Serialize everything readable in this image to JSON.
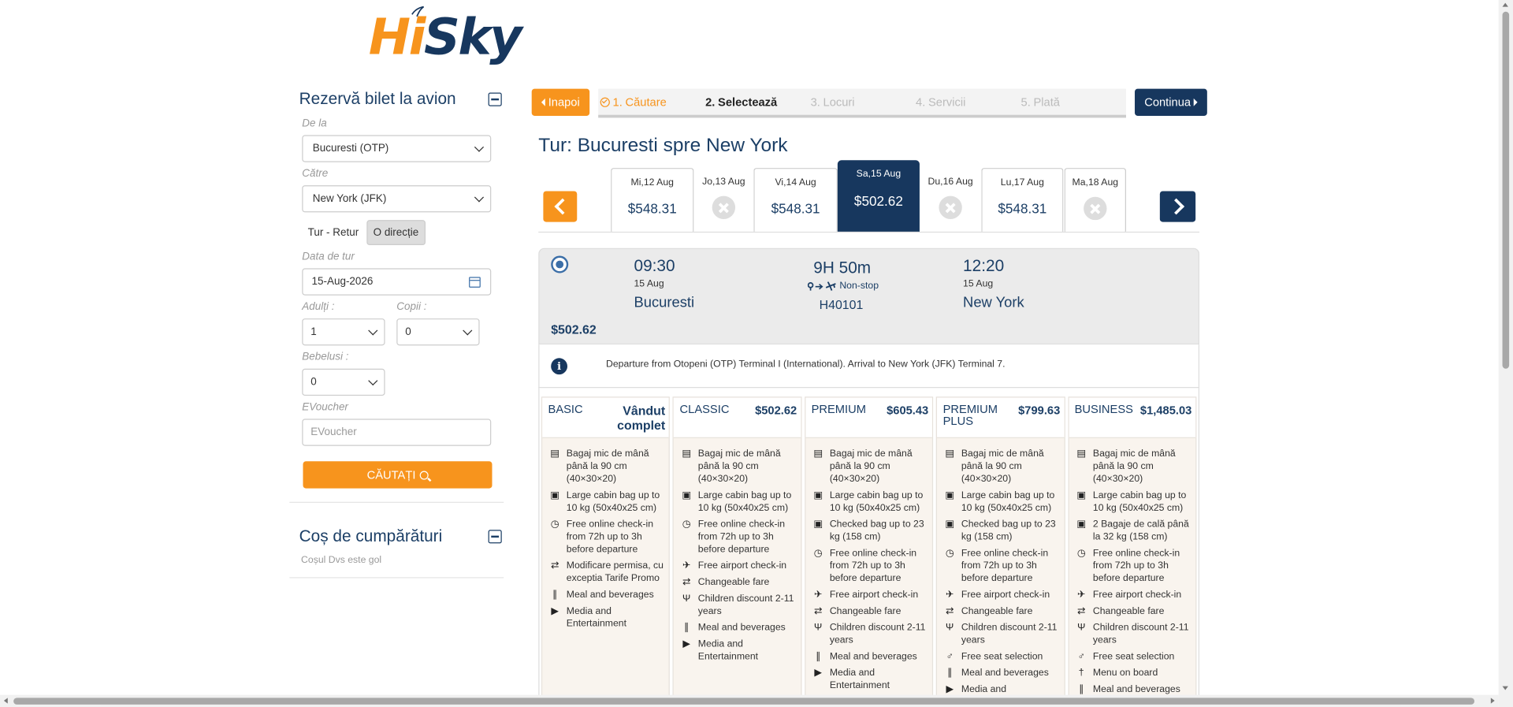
{
  "brand": {
    "hi": "Hi",
    "sky": "Sky"
  },
  "booking_panel": {
    "title": "Rezervă bilet la avion",
    "from_label": "De la",
    "from_value": "Bucuresti (OTP)",
    "to_label": "Către",
    "to_value": "New York (JFK)",
    "trip_round": "Tur - Retur",
    "trip_oneway": "O direcție",
    "date_label": "Data de tur",
    "date_value": "15-Aug-2026",
    "adults_label": "Adulți :",
    "adults_value": "1",
    "children_label": "Copii :",
    "children_value": "0",
    "infants_label": "Bebelusi :",
    "infants_value": "0",
    "voucher_label": "EVoucher",
    "voucher_placeholder": "EVoucher",
    "search_button": "CĂUTAȚI"
  },
  "cart": {
    "title": "Coș de cumpărături",
    "empty_text": "Coșul Dvs este gol"
  },
  "nav": {
    "back": "Inapoi",
    "continue": "Continua",
    "steps": [
      {
        "num": "1.",
        "label": "Căutare"
      },
      {
        "num": "2.",
        "label": "Selectează"
      },
      {
        "num": "3.",
        "label": "Locuri"
      },
      {
        "num": "4.",
        "label": "Servicii"
      },
      {
        "num": "5.",
        "label": "Plată"
      }
    ]
  },
  "route_title": "Tur: Bucuresti spre New York",
  "dates": [
    {
      "label": "Mi,12 Aug",
      "price": "$548.31",
      "available": true
    },
    {
      "label": "Jo,13 Aug",
      "price": "",
      "available": false
    },
    {
      "label": "Vi,14 Aug",
      "price": "$548.31",
      "available": true
    },
    {
      "label": "Sa,15 Aug",
      "price": "$502.62",
      "available": true,
      "selected": true
    },
    {
      "label": "Du,16 Aug",
      "price": "",
      "available": false
    },
    {
      "label": "Lu,17 Aug",
      "price": "$548.31",
      "available": true
    },
    {
      "label": "Ma,18 Aug",
      "price": "",
      "available": false
    }
  ],
  "flight": {
    "dep_time": "09:30",
    "dep_date": "15 Aug",
    "dep_city": "Bucuresti",
    "duration": "9H 50m",
    "stops": "Non-stop",
    "number": "H40101",
    "arr_time": "12:20",
    "arr_date": "15 Aug",
    "arr_city": "New York",
    "price": "$502.62",
    "info": "Departure from Otopeni (OTP) Terminal I (International). Arrival to New York (JFK) Terminal 7."
  },
  "fares": [
    {
      "name": "BASIC",
      "price": "Vândut complet",
      "sold_out": true,
      "features": [
        {
          "icon": "briefcase-icon",
          "text": "Bagaj mic de mână până la 90 cm (40×30×20)"
        },
        {
          "icon": "suitcase-icon",
          "text": "Large cabin bag up to 10 kg (50x40x25 cm)"
        },
        {
          "icon": "clock-icon",
          "text": "Free online check-in from 72h up to 3h before departure"
        },
        {
          "icon": "exchange-icon",
          "text": "Modificare permisa, cu exceptia Tarife Promo"
        },
        {
          "icon": "cutlery-icon",
          "text": "Meal and beverages"
        },
        {
          "icon": "media-icon",
          "text": "Media and Entertainment"
        }
      ]
    },
    {
      "name": "CLASSIC",
      "price": "$502.62",
      "sold_out": false,
      "features": [
        {
          "icon": "briefcase-icon",
          "text": "Bagaj mic de mână până la 90 cm (40×30×20)"
        },
        {
          "icon": "suitcase-icon",
          "text": "Large cabin bag up to 10 kg (50x40x25 cm)"
        },
        {
          "icon": "clock-icon",
          "text": "Free online check-in from 72h up to 3h before departure"
        },
        {
          "icon": "plane-icon",
          "text": "Free airport check-in"
        },
        {
          "icon": "exchange-icon",
          "text": "Changeable fare"
        },
        {
          "icon": "child-icon",
          "text": "Children discount 2-11 years"
        },
        {
          "icon": "cutlery-icon",
          "text": "Meal and beverages"
        },
        {
          "icon": "media-icon",
          "text": "Media and Entertainment"
        }
      ]
    },
    {
      "name": "PREMIUM",
      "price": "$605.43",
      "sold_out": false,
      "features": [
        {
          "icon": "briefcase-icon",
          "text": "Bagaj mic de mână până la 90 cm (40×30×20)"
        },
        {
          "icon": "suitcase-icon",
          "text": "Large cabin bag up to 10 kg (50x40x25 cm)"
        },
        {
          "icon": "suitcase-icon",
          "text": "Checked bag up to 23 kg (158 cm)"
        },
        {
          "icon": "clock-icon",
          "text": "Free online check-in from 72h up to 3h before departure"
        },
        {
          "icon": "plane-icon",
          "text": "Free airport check-in"
        },
        {
          "icon": "exchange-icon",
          "text": "Changeable fare"
        },
        {
          "icon": "child-icon",
          "text": "Children discount 2-11 years"
        },
        {
          "icon": "cutlery-icon",
          "text": "Meal and beverages"
        },
        {
          "icon": "media-icon",
          "text": "Media and Entertainment"
        }
      ]
    },
    {
      "name": "PREMIUM PLUS",
      "price": "$799.63",
      "sold_out": false,
      "features": [
        {
          "icon": "briefcase-icon",
          "text": "Bagaj mic de mână până la 90 cm (40×30×20)"
        },
        {
          "icon": "suitcase-icon",
          "text": "Large cabin bag up to 10 kg (50x40x25 cm)"
        },
        {
          "icon": "suitcase-icon",
          "text": "Checked bag up to 23 kg (158 cm)"
        },
        {
          "icon": "clock-icon",
          "text": "Free online check-in from 72h up to 3h before departure"
        },
        {
          "icon": "plane-icon",
          "text": "Free airport check-in"
        },
        {
          "icon": "exchange-icon",
          "text": "Changeable fare"
        },
        {
          "icon": "child-icon",
          "text": "Children discount 2-11 years"
        },
        {
          "icon": "seat-icon",
          "text": "Free seat selection"
        },
        {
          "icon": "cutlery-icon",
          "text": "Meal and beverages"
        },
        {
          "icon": "media-icon",
          "text": "Media and"
        }
      ]
    },
    {
      "name": "BUSINESS",
      "price": "$1,485.03",
      "sold_out": false,
      "features": [
        {
          "icon": "briefcase-icon",
          "text": "Bagaj mic de mână până la 90 cm (40×30×20)"
        },
        {
          "icon": "suitcase-icon",
          "text": "Large cabin bag up to 10 kg (50x40x25 cm)"
        },
        {
          "icon": "suitcase-icon",
          "text": "2 Bagaje de cală până la 32 kg (158 cm)"
        },
        {
          "icon": "clock-icon",
          "text": "Free online check-in from 72h up to 3h before departure"
        },
        {
          "icon": "plane-icon",
          "text": "Free airport check-in"
        },
        {
          "icon": "exchange-icon",
          "text": "Changeable fare"
        },
        {
          "icon": "child-icon",
          "text": "Children discount 2-11 years"
        },
        {
          "icon": "seat-icon",
          "text": "Free seat selection"
        },
        {
          "icon": "menu-icon",
          "text": "Menu on board"
        },
        {
          "icon": "cutlery-icon",
          "text": "Meal and beverages"
        }
      ]
    }
  ],
  "colors": {
    "accent": "#f7941d",
    "brand": "#17375e",
    "heading": "#1c3f66"
  }
}
